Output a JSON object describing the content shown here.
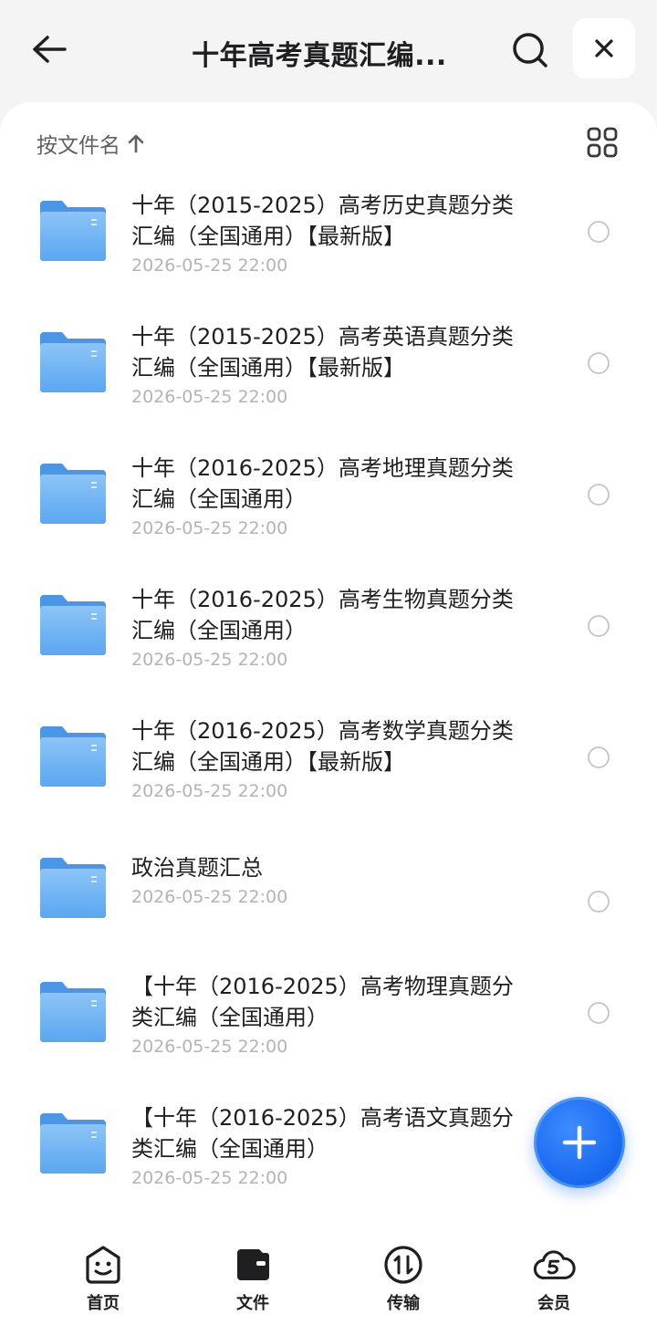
{
  "header": {
    "title": "十年高考真题汇编...",
    "back_icon": "arrow-left-icon",
    "search_icon": "search-icon",
    "close_icon": "close-icon"
  },
  "sort": {
    "label": "按文件名",
    "direction_icon": "arrow-up-icon",
    "view_icon": "grid-view-icon"
  },
  "files": [
    {
      "name": "十年（2015-2025）高考历史真题分类汇编（全国通用）【最新版】",
      "date": "2026-05-25 22:00"
    },
    {
      "name": "十年（2015-2025）高考英语真题分类汇编（全国通用）【最新版】",
      "date": "2026-05-25 22:00"
    },
    {
      "name": "十年（2016-2025）高考地理真题分类汇编（全国通用）",
      "date": "2026-05-25 22:00"
    },
    {
      "name": "十年（2016-2025）高考生物真题分类汇编（全国通用）",
      "date": "2026-05-25 22:00"
    },
    {
      "name": "十年（2016-2025）高考数学真题分类汇编（全国通用）【最新版】",
      "date": "2026-05-25 22:00"
    },
    {
      "name": "政治真题汇总",
      "date": "2026-05-25 22:00"
    },
    {
      "name": "【十年（2016-2025）高考物理真题分类汇编（全国通用）",
      "date": "2026-05-25 22:00"
    },
    {
      "name": "【十年（2016-2025）高考语文真题分类汇编（全国通用）",
      "date": "2026-05-25 22:00"
    }
  ],
  "fab": {
    "icon": "plus-icon"
  },
  "nav": [
    {
      "label": "首页",
      "icon": "home-face-icon"
    },
    {
      "label": "文件",
      "icon": "wallet-folder-icon"
    },
    {
      "label": "传输",
      "icon": "transfer-icon"
    },
    {
      "label": "会员",
      "icon": "vip-cloud-icon"
    }
  ],
  "colors": {
    "accent": "#1b6cf2",
    "folder": "#5aa6f0",
    "text": "#1f1f22",
    "muted": "#b3b3b8"
  }
}
